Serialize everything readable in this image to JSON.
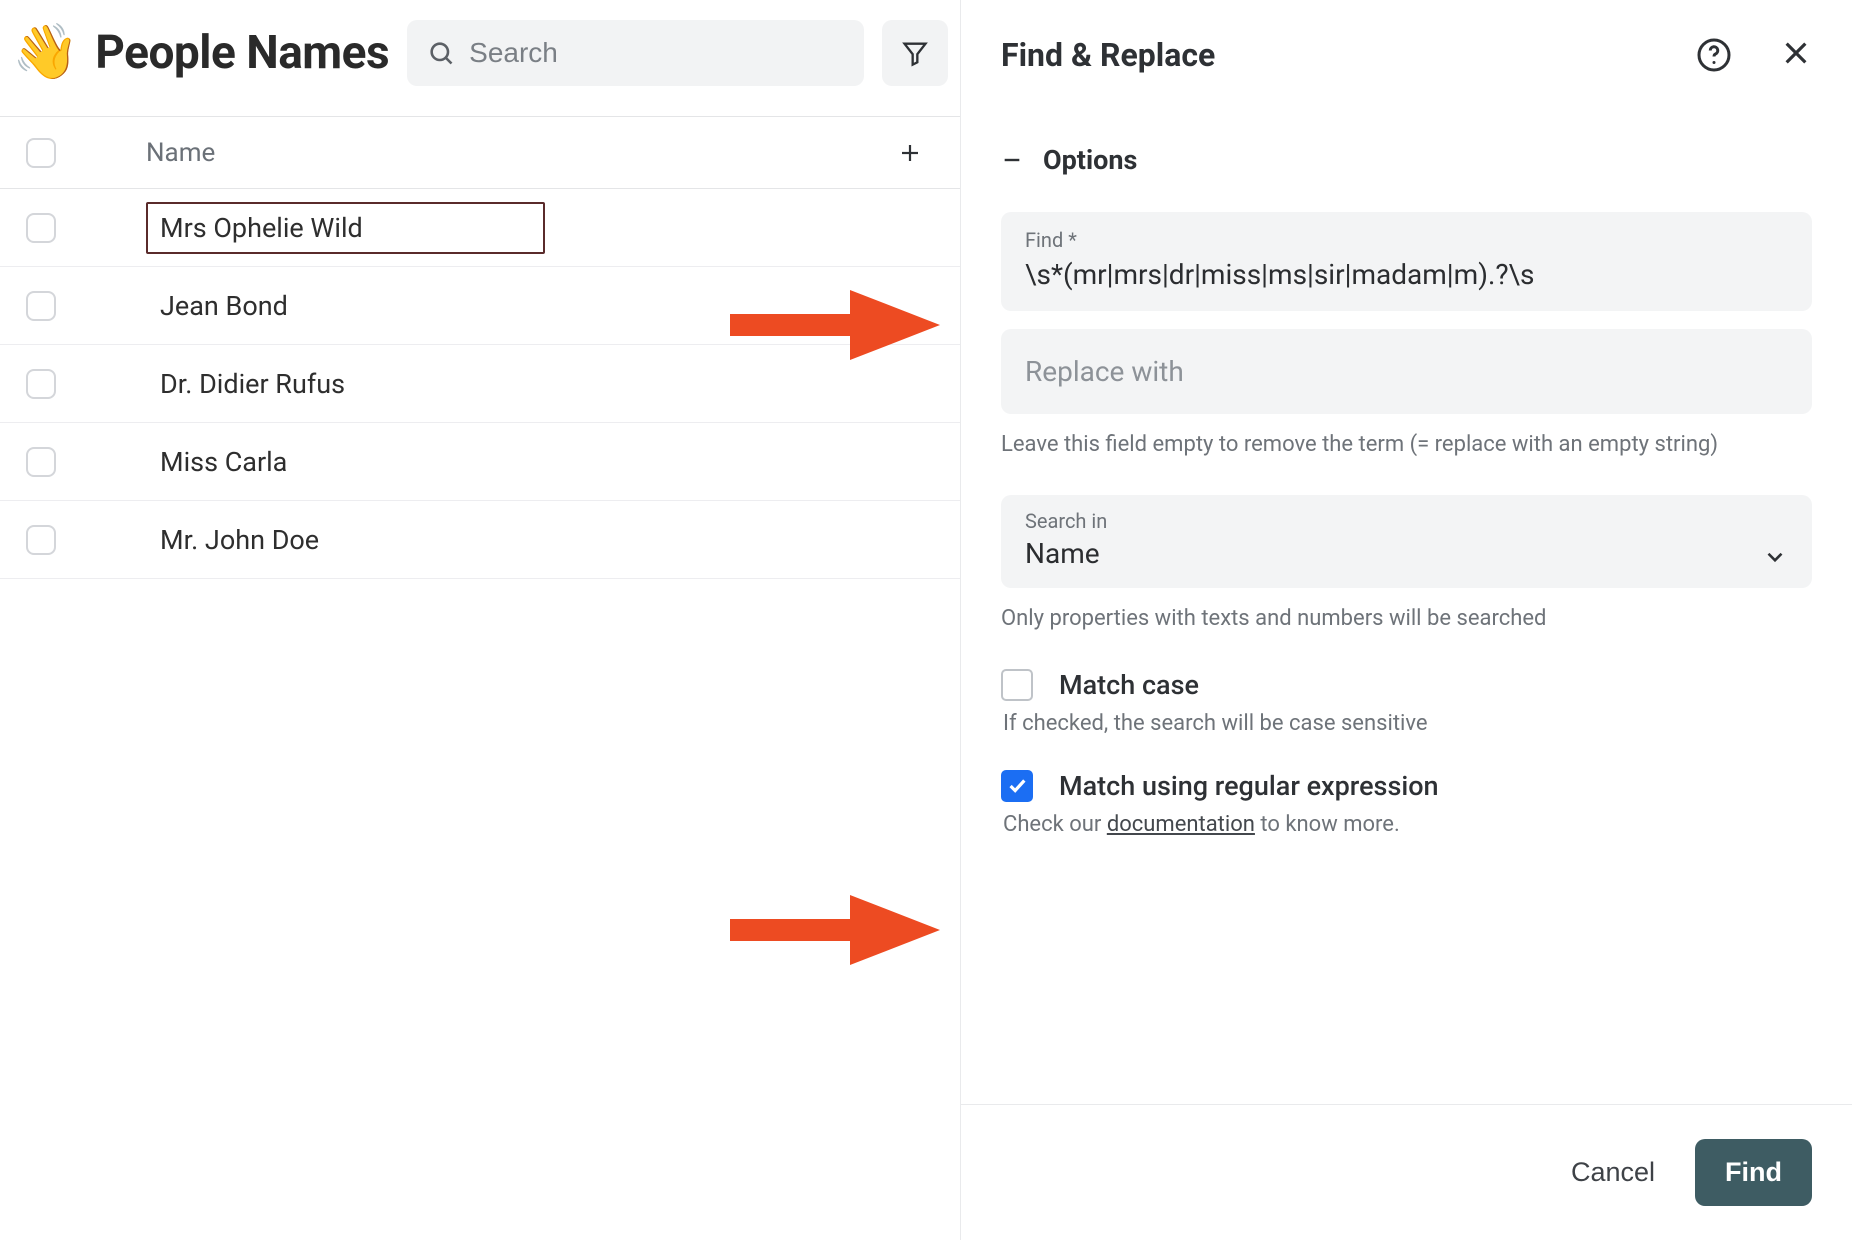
{
  "left": {
    "emoji": "👋",
    "title": "People Names",
    "search_placeholder": "Search",
    "name_header": "Name",
    "rows": [
      {
        "name": "Mrs Ophelie Wild",
        "selected": true
      },
      {
        "name": "Jean Bond",
        "selected": false
      },
      {
        "name": "Dr. Didier Rufus",
        "selected": false
      },
      {
        "name": "Miss Carla",
        "selected": false
      },
      {
        "name": "Mr. John Doe",
        "selected": false
      }
    ]
  },
  "panel": {
    "title": "Find & Replace",
    "options_label": "Options",
    "find": {
      "label": "Find *",
      "value": "\\s*(mr|mrs|dr|miss|ms|sir|madam|m).?\\s"
    },
    "replace": {
      "placeholder": "Replace with",
      "help": "Leave this field empty to remove the term (= replace with an empty string)"
    },
    "search_in": {
      "label": "Search in",
      "value": "Name",
      "help": "Only properties with texts and numbers will be searched"
    },
    "match_case": {
      "label": "Match case",
      "checked": false,
      "help": "If checked, the search will be case sensitive"
    },
    "match_regex": {
      "label": "Match using regular expression",
      "checked": true,
      "help_prefix": "Check our ",
      "help_link": "documentation",
      "help_suffix": " to know more."
    },
    "actions": {
      "cancel": "Cancel",
      "find": "Find"
    }
  }
}
